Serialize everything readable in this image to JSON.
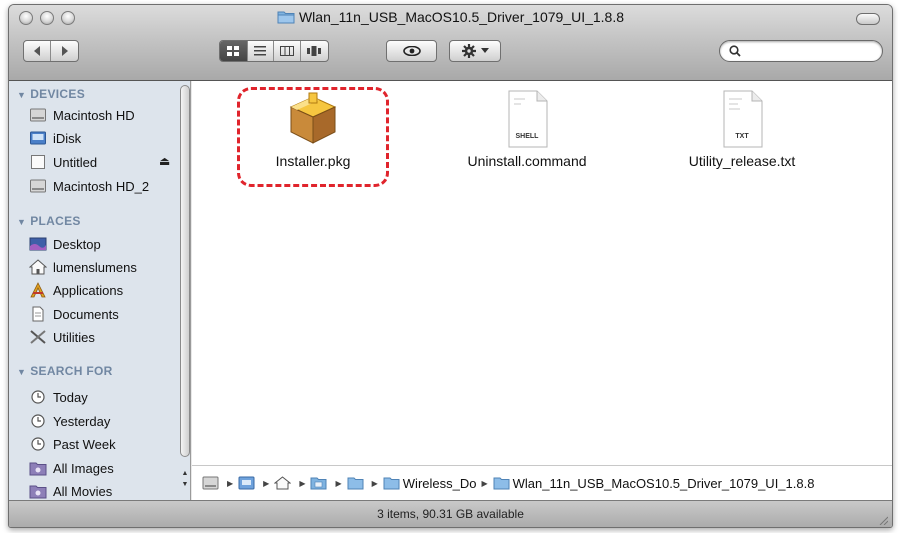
{
  "window": {
    "title": "Wlan_11n_USB_MacOS10.5_Driver_1079_UI_1.8.8"
  },
  "search": {
    "placeholder": "",
    "value": ""
  },
  "sidebar": {
    "sections": [
      {
        "heading": "DEVICES",
        "items": [
          {
            "label": "Macintosh HD",
            "icon": "hard-drive-icon"
          },
          {
            "label": "iDisk",
            "icon": "idisk-icon"
          },
          {
            "label": "Untitled",
            "icon": "disk-image-icon",
            "eject": "⏏"
          },
          {
            "label": "Macintosh HD_2",
            "icon": "hard-drive-icon"
          }
        ]
      },
      {
        "heading": "PLACES",
        "items": [
          {
            "label": "Desktop",
            "icon": "desktop-icon"
          },
          {
            "label": "lumenslumens",
            "icon": "home-icon"
          },
          {
            "label": "Applications",
            "icon": "applications-icon"
          },
          {
            "label": "Documents",
            "icon": "documents-icon"
          },
          {
            "label": "Utilities",
            "icon": "utilities-icon"
          }
        ]
      },
      {
        "heading": "SEARCH FOR",
        "items": [
          {
            "label": "Today",
            "icon": "clock-icon"
          },
          {
            "label": "Yesterday",
            "icon": "clock-icon"
          },
          {
            "label": "Past Week",
            "icon": "clock-icon"
          },
          {
            "label": "All Images",
            "icon": "smart-folder-icon"
          },
          {
            "label": "All Movies",
            "icon": "smart-folder-icon"
          }
        ]
      }
    ]
  },
  "files": [
    {
      "name": "Installer.pkg",
      "icon": "package-icon",
      "highlighted": true
    },
    {
      "name": "Uninstall.command",
      "icon": "shell-document-icon",
      "badge": "SHELL"
    },
    {
      "name": "Utility_release.txt",
      "icon": "text-document-icon",
      "badge": "TXT"
    }
  ],
  "pathbar": {
    "segments": [
      "Wireless_Do",
      "Wlan_11n_USB_MacOS10.5_Driver_1079_UI_1.8.8"
    ]
  },
  "status": {
    "text": "3 items, 90.31 GB available"
  },
  "colors": {
    "highlight": "#e0242c",
    "sidebar_bg": "#dde4ec",
    "section_heading": "#7187a2"
  }
}
